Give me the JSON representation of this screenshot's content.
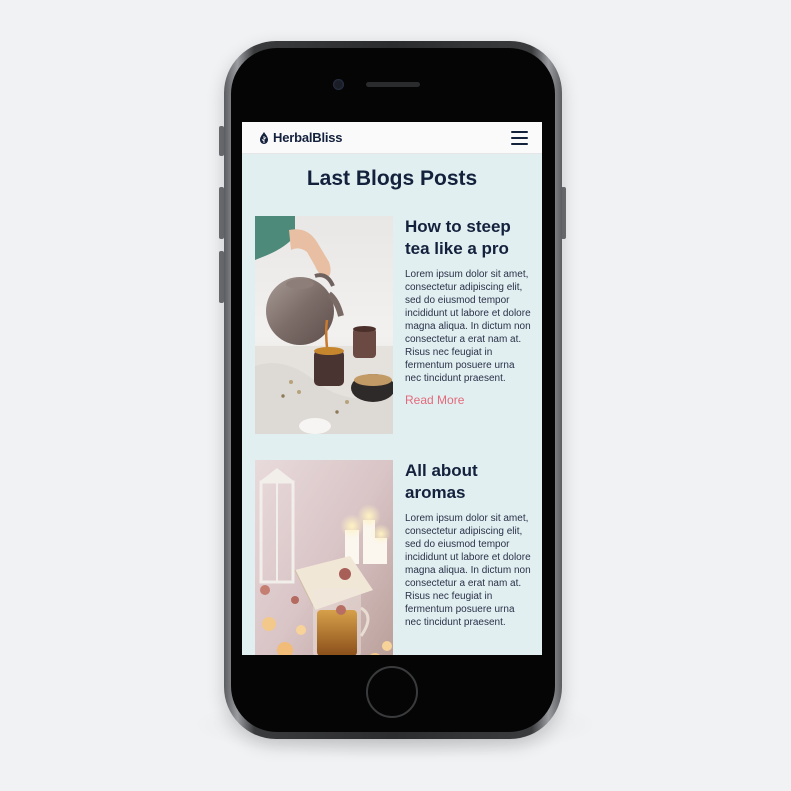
{
  "app": {
    "brand": "HerbalBliss",
    "menu_icon": "hamburger-menu-icon",
    "accent_color": "#e46a7a",
    "title_color": "#14213d",
    "page_background": "#e1eff1"
  },
  "page": {
    "title": "Last Blogs Posts"
  },
  "posts": [
    {
      "title": "How to steep tea like a pro",
      "excerpt": "Lorem ipsum dolor sit amet, consectetur adipiscing elit, sed do eiusmod tempor incididunt ut labore et dolore magna aliqua. In dictum non consectetur a erat nam at. Risus nec feugiat in fermentum posuere urna nec tincidunt praesent.",
      "link": "Read More",
      "image": "pouring-tea-photo"
    },
    {
      "title": "All about aromas",
      "excerpt": "Lorem ipsum dolor sit amet, consectetur adipiscing elit, sed do eiusmod tempor incididunt ut labore et dolore magna aliqua. In dictum non consectetur a erat nam at. Risus nec feugiat in fermentum posuere urna nec tincidunt praesent.",
      "image": "candles-and-tea-photo"
    }
  ]
}
